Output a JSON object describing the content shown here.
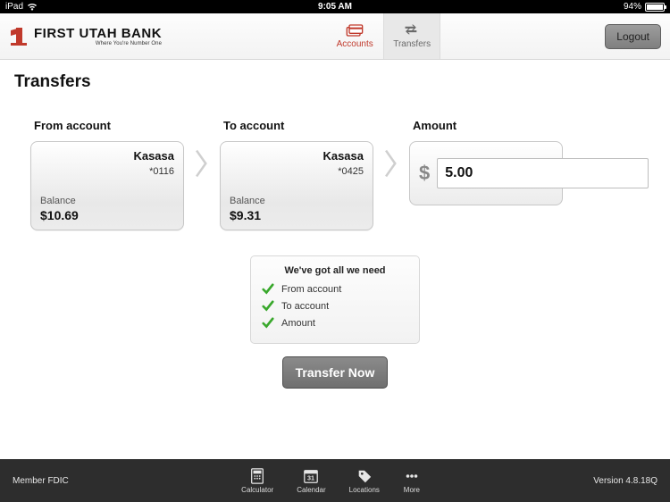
{
  "statusbar": {
    "device": "iPad",
    "time": "9:05 AM",
    "battery_pct": "94%"
  },
  "header": {
    "brand_name": "FIRST UTAH BANK",
    "brand_tagline": "Where You're Number One",
    "tabs": {
      "accounts": "Accounts",
      "transfers": "Transfers"
    },
    "logout": "Logout"
  },
  "page": {
    "title": "Transfers",
    "from_label": "From account",
    "to_label": "To account",
    "amount_label": "Amount",
    "from": {
      "name": "Kasasa",
      "mask": "*0116",
      "balance_label": "Balance",
      "balance": "$10.69"
    },
    "to": {
      "name": "Kasasa",
      "mask": "*0425",
      "balance_label": "Balance",
      "balance": "$9.31"
    },
    "amount": {
      "currency": "$",
      "value": "5.00"
    },
    "summary": {
      "heading": "We've got all we need",
      "items": [
        "From account",
        "To account",
        "Amount"
      ]
    },
    "cta": "Transfer Now"
  },
  "footer": {
    "left": "Member FDIC",
    "tools": {
      "calculator": "Calculator",
      "calendar": "Calendar",
      "calendar_day": "31",
      "locations": "Locations",
      "more": "More"
    },
    "version": "Version 4.8.18Q"
  },
  "colors": {
    "accent": "#c0392b",
    "ok": "#39a82c"
  }
}
